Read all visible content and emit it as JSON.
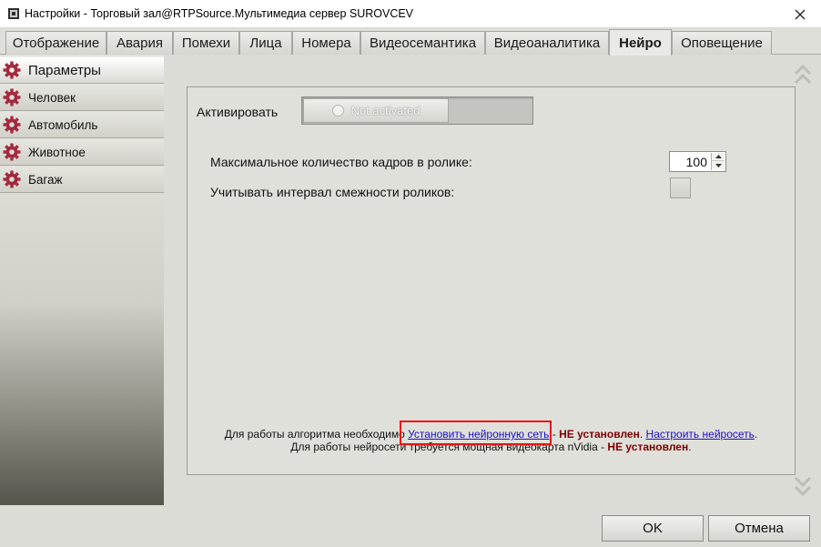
{
  "window": {
    "title": "Настройки - Торговый зал@RTPSource.Мультимедиа сервер SUROVCEV",
    "close_glyph": "✕"
  },
  "tabs": [
    {
      "label": "Отображение",
      "active": false
    },
    {
      "label": "Авария",
      "active": false
    },
    {
      "label": "Помехи",
      "active": false
    },
    {
      "label": "Лица",
      "active": false
    },
    {
      "label": "Номера",
      "active": false
    },
    {
      "label": "Видеосемантика",
      "active": false
    },
    {
      "label": "Видеоаналитика",
      "active": false
    },
    {
      "label": "Нейро",
      "active": true
    },
    {
      "label": "Оповещение",
      "active": false
    }
  ],
  "sidebar": {
    "items": [
      {
        "label": "Параметры",
        "active": true,
        "icon": "gear-icon"
      },
      {
        "label": "Человек",
        "active": false,
        "icon": "gear-icon"
      },
      {
        "label": "Автомобиль",
        "active": false,
        "icon": "gear-icon"
      },
      {
        "label": "Животное",
        "active": false,
        "icon": "gear-icon"
      },
      {
        "label": "Багаж",
        "active": false,
        "icon": "gear-icon"
      }
    ]
  },
  "main": {
    "activate_label": "Активировать",
    "toggle_state": "Not activated",
    "max_frames_label": "Максимальное количество кадров в ролике:",
    "max_frames_value": "100",
    "interval_label": "Учитывать интервал смежности роликов:",
    "interval_checked": false,
    "info_line1_prefix": "Для работы алгоритма необходимо",
    "install_link": "Установить нейронную сеть",
    "dash": " - ",
    "not_installed": "НЕ установлен",
    "configure_link": "Настроить нейросеть",
    "period": ".",
    "info_line2_prefix": "Для работы нейросети требуется мощная видеокарта nVidia - ",
    "not_installed_2": "НЕ установлен"
  },
  "buttons": {
    "ok": "OK",
    "cancel": "Отмена"
  },
  "colors": {
    "accent_gear": "#a32a3e",
    "error_text": "#7a0000",
    "link": "#1a0dcc",
    "highlight": "#e81414"
  }
}
